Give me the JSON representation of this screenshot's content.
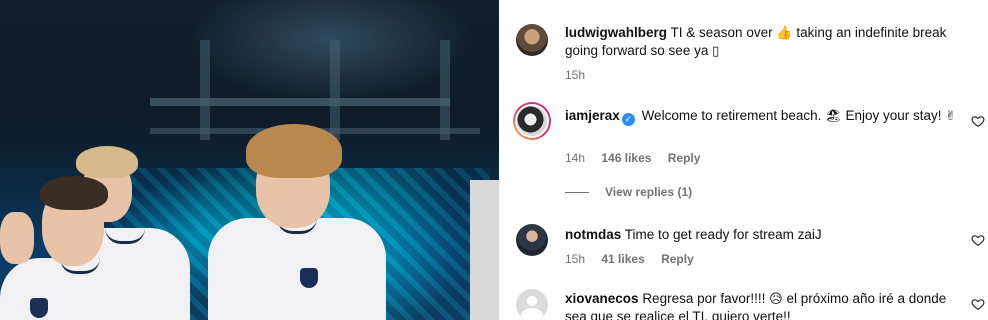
{
  "comments": [
    {
      "username": "ludwigwahlberg",
      "text_a": "TI & season over",
      "emoji_a": "👍",
      "text_b": "taking an indefinite break going forward so see ya",
      "emoji_b": "▯",
      "time": "15h",
      "likes": "",
      "reply": ""
    },
    {
      "username": "iamjerax",
      "verified": true,
      "text_a": "Welcome to retirement beach.",
      "emoji_a": "🏖",
      "text_b": "Enjoy your stay!",
      "emoji_b": "✌",
      "time": "14h",
      "likes": "146 likes",
      "reply": "Reply"
    },
    {
      "username": "notmdas",
      "text_a": "Time to get ready for stream zaiJ",
      "time": "15h",
      "likes": "41 likes",
      "reply": "Reply"
    },
    {
      "username": "xiovanecos",
      "text_a": "Regresa por favor!!!!",
      "emoji_a": "😥",
      "text_b": "el próximo año iré a donde sea que se realice el TI, quiero verte!!"
    }
  ],
  "view_replies": "View replies (1)",
  "icons": {
    "heart": "heart-icon",
    "verified": "verified-badge-icon"
  },
  "colors": {
    "meta_text": "#737373",
    "verified_blue": "#2b8df6",
    "jersey_white": "#f1f1f3",
    "jersey_navy": "#1c2e55"
  }
}
